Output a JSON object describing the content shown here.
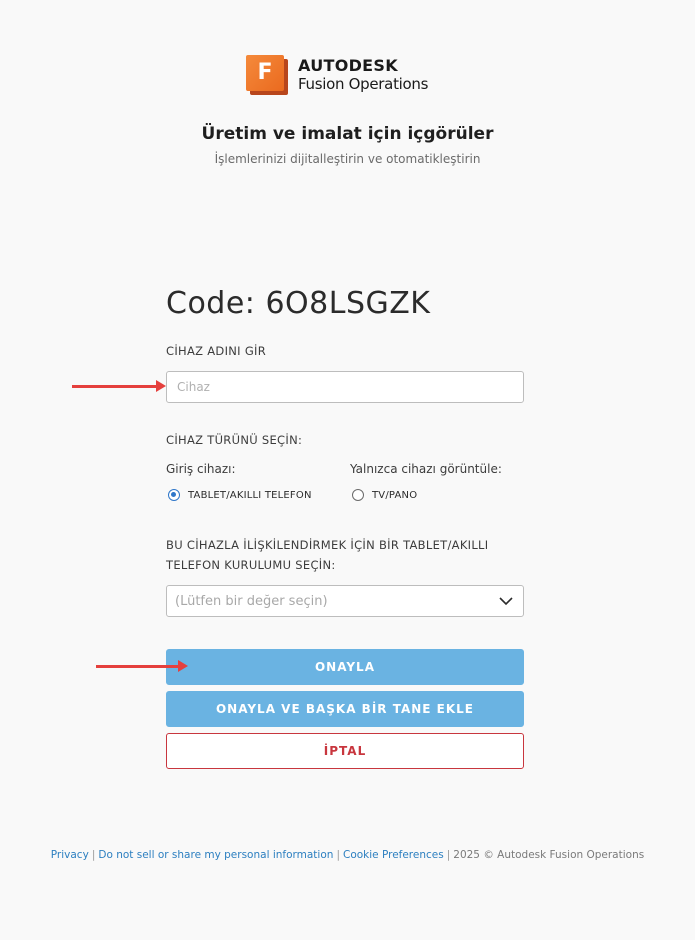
{
  "header": {
    "brand": "AUTODESK",
    "product": "Fusion Operations",
    "logo_letter": "F",
    "headline": "Üretim ve imalat için içgörüler",
    "subline": "İşlemlerinizi dijitalleştirin ve otomatikleştirin"
  },
  "form": {
    "code_text": "Code: 6O8LSGZK",
    "device_name_label": "CİHAZ ADINI GİR",
    "device_name_placeholder": "Cihaz",
    "device_name_value": "",
    "device_type_label": "CİHAZ TÜRÜNÜ SEÇİN:",
    "input_device_group": "Giriş cihazı:",
    "display_only_group": "Yalnızca cihazı görüntüle:",
    "radio_tablet": "TABLET/AKILLI TELEFON",
    "radio_tv": "TV/PANO",
    "selected_radio": "TABLET/AKILLI TELEFON",
    "link_label_line1": "BU CİHAZLA İLİŞKİLENDİRMEK İÇİN BİR TABLET/AKILLI",
    "link_label_line2": "TELEFON KURULUMU SEÇİN:",
    "select_placeholder": "(Lütfen bir değer seçin)"
  },
  "buttons": {
    "confirm": "ONAYLA",
    "confirm_add_another": "ONAYLA VE BAŞKA BİR TANE EKLE",
    "cancel": "İPTAL"
  },
  "footer": {
    "privacy": "Privacy",
    "do_not_sell": "Do not sell or share my personal information",
    "cookie_prefs": "Cookie Preferences",
    "copyright": "2025 © Autodesk Fusion Operations"
  },
  "colors": {
    "primary_button": "#6ab3e2",
    "cancel_accent": "#c8363e",
    "annotation_arrow": "#e5403d",
    "link": "#2c7fc0",
    "logo_orange": "#f58a3b"
  },
  "icons": {
    "select_caret": "chevron-down-icon",
    "annotation": "arrow-right-icon"
  }
}
